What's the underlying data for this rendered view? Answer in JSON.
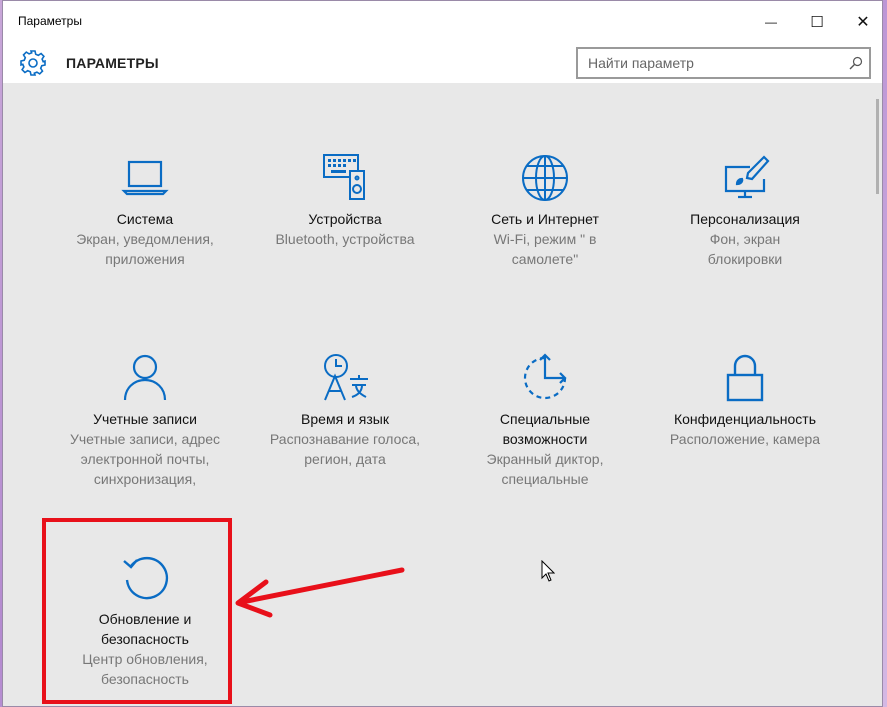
{
  "window": {
    "title": "Параметры",
    "buttons": {
      "minimize": "—",
      "maximize": "☐",
      "close": "✕"
    }
  },
  "header": {
    "app_title": "ПАРАМЕТРЫ",
    "search_placeholder": "Найти параметр"
  },
  "colors": {
    "accent": "#0a6cc4",
    "highlight": "#e8101a"
  },
  "tiles": [
    {
      "icon": "laptop-icon",
      "name": "Система",
      "desc1": "Экран, уведомления,",
      "desc2": "приложения",
      "desc3": ""
    },
    {
      "icon": "keyboard-speaker-icon",
      "name": "Устройства",
      "desc1": "Bluetooth, устройства",
      "desc2": "",
      "desc3": ""
    },
    {
      "icon": "globe-icon",
      "name": "Сеть и Интернет",
      "desc1": "Wi-Fi, режим \" в",
      "desc2": "самолете\"",
      "desc3": ""
    },
    {
      "icon": "paint-icon",
      "name": "Персонализация",
      "desc1": "Фон, экран",
      "desc2": "блокировки",
      "desc3": ""
    },
    {
      "icon": "person-icon",
      "name": "Учетные записи",
      "desc1": "Учетные записи, адрес",
      "desc2": "электронной почты,",
      "desc3": "синхронизация,"
    },
    {
      "icon": "time-language-icon",
      "name": "Время и язык",
      "desc1": "Распознавание голоса,",
      "desc2": "регион, дата",
      "desc3": ""
    },
    {
      "icon": "ease-of-access-icon",
      "name": "Специальные",
      "name2": "возможности",
      "desc1": "Экранный диктор,",
      "desc2": "специальные",
      "desc3": ""
    },
    {
      "icon": "lock-icon",
      "name": "Конфиденциальность",
      "desc1": "Расположение, камера",
      "desc2": "",
      "desc3": ""
    },
    {
      "icon": "update-icon",
      "name": "Обновление и",
      "name2": "безопасность",
      "desc1": "Центр обновления,",
      "desc2": "безопасность",
      "desc3": ""
    }
  ]
}
